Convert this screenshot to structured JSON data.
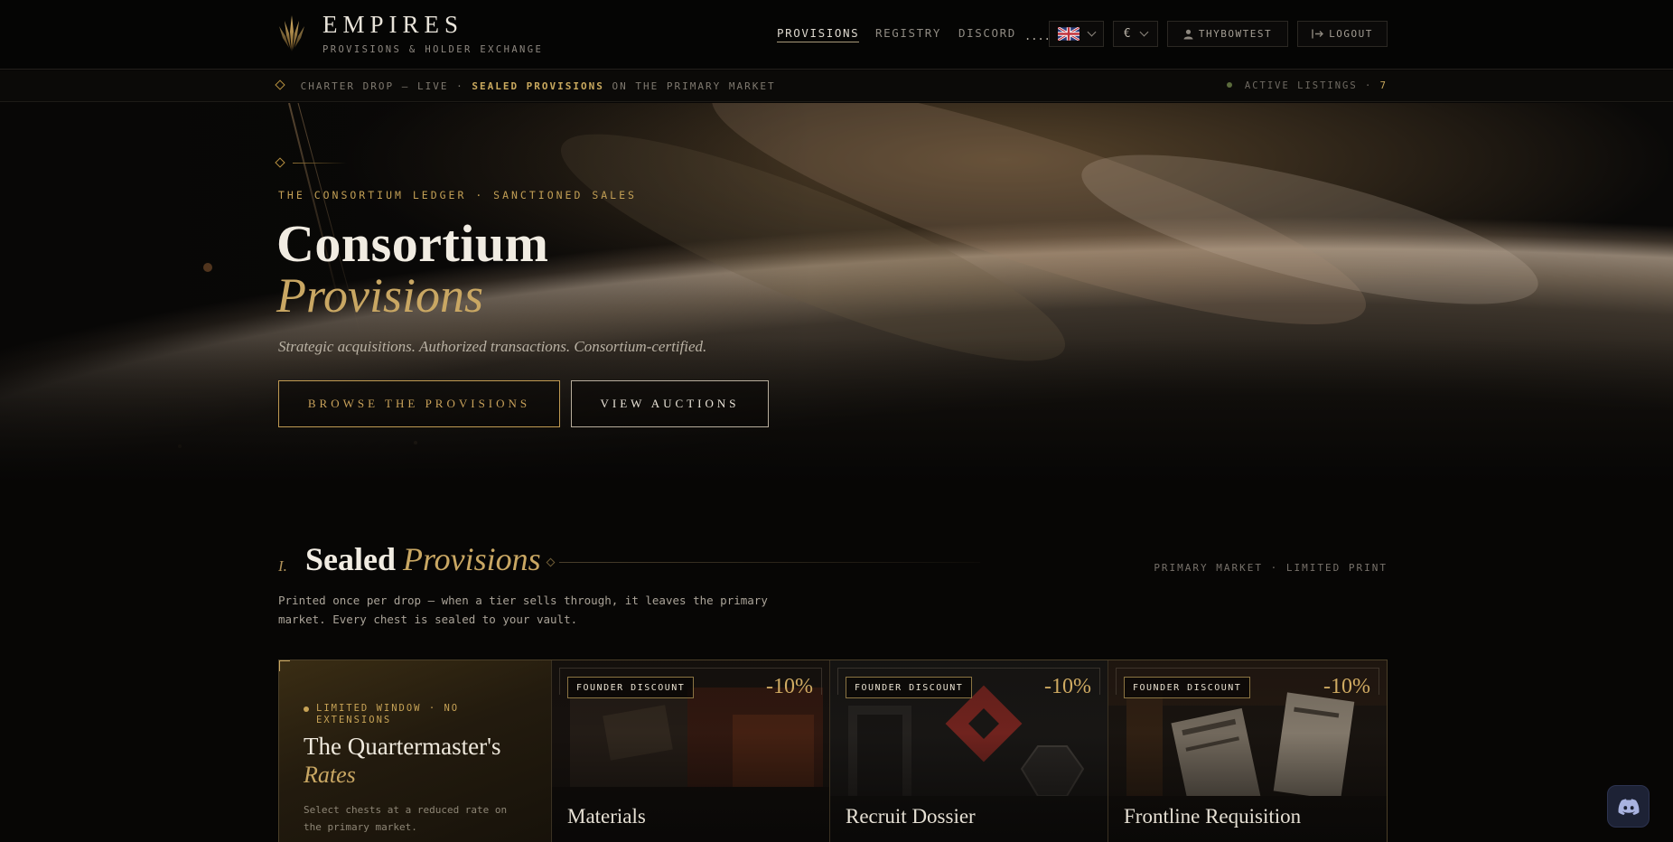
{
  "brand": {
    "name": "EMPIRES",
    "subtitle": "PROVISIONS & HOLDER EXCHANGE"
  },
  "nav": {
    "links": [
      {
        "label": "PROVISIONS",
        "active": true
      },
      {
        "label": "REGISTRY",
        "active": false
      },
      {
        "label": "DISCORD",
        "active": false
      }
    ],
    "status_dots": "....",
    "language": {
      "icon": "uk-flag-icon"
    },
    "currency": {
      "symbol": "€"
    },
    "user": {
      "label": "THYBOWTEST",
      "icon": "user-icon"
    },
    "logout": {
      "label": "LOGOUT",
      "icon": "logout-icon"
    }
  },
  "ticker": {
    "prefix": "CHARTER DROP — LIVE ·",
    "highlight": "SEALED PROVISIONS",
    "suffix": "ON THE PRIMARY MARKET",
    "active_label": "ACTIVE LISTINGS ·",
    "active_count": "7"
  },
  "hero": {
    "eyebrow": "THE CONSORTIUM LEDGER · SANCTIONED SALES",
    "title_line1": "Consortium",
    "title_line2": "Provisions",
    "tagline": "Strategic acquisitions. Authorized transactions. Consortium-certified.",
    "primary_button": "BROWSE THE PROVISIONS",
    "secondary_button": "VIEW AUCTIONS"
  },
  "section": {
    "number": "I.",
    "title_a": "Sealed",
    "title_b": "Provisions",
    "meta": "PRIMARY MARKET · LIMITED PRINT",
    "description": "Printed once per drop — when a tier sells through, it leaves the primary market. Every chest is sealed to your vault."
  },
  "rates_card": {
    "tag": "LIMITED WINDOW · NO EXTENSIONS",
    "title_a": "The Quartermaster's",
    "title_b": "Rates",
    "description": "Select chests at a reduced rate on the primary market."
  },
  "cards": [
    {
      "badge": "FOUNDER DISCOUNT",
      "discount": "-10%",
      "name": "Materials"
    },
    {
      "badge": "FOUNDER DISCOUNT",
      "discount": "-10%",
      "name": "Recruit Dossier"
    },
    {
      "badge": "FOUNDER DISCOUNT",
      "discount": "-10%",
      "name": "Frontline Requisition"
    }
  ],
  "colors": {
    "background": "#070605",
    "accent_gold": "#c9a763",
    "text_primary": "#f1ece2",
    "text_muted": "#8f8a82"
  },
  "floating": {
    "discord_icon": "discord-icon"
  }
}
